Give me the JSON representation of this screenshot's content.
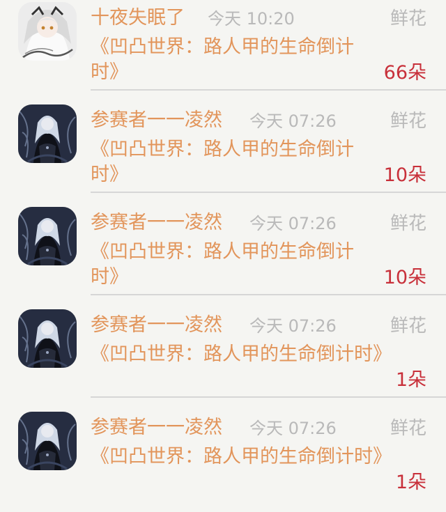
{
  "items": [
    {
      "user": "十夜失眠了",
      "time": "今天 10:20",
      "gift_label": "鲜花",
      "book": "《凹凸世界：路人甲的生命倒计时》",
      "count": "66朵",
      "avatar": "avatar-girl-white-hair"
    },
    {
      "user": "参赛者一一凌然",
      "time": "今天 07:26",
      "gift_label": "鲜花",
      "book": "《凹凸世界：路人甲的生命倒计时》",
      "count": "10朵",
      "avatar": "avatar-dark-anime"
    },
    {
      "user": "参赛者一一凌然",
      "time": "今天 07:26",
      "gift_label": "鲜花",
      "book": "《凹凸世界：路人甲的生命倒计时》",
      "count": "10朵",
      "avatar": "avatar-dark-anime"
    },
    {
      "user": "参赛者一一凌然",
      "time": "今天 07:26",
      "gift_label": "鲜花",
      "book": "《凹凸世界：路人甲的生命倒计时》",
      "count": "1朵",
      "avatar": "avatar-dark-anime"
    },
    {
      "user": "参赛者一一凌然",
      "time": "今天 07:26",
      "gift_label": "鲜花",
      "book": "《凹凸世界：路人甲的生命倒计时》",
      "count": "1朵",
      "avatar": "avatar-dark-anime"
    }
  ],
  "colors": {
    "name": "#e2955b",
    "time": "#b9b9b9",
    "count": "#c8303a",
    "background": "#f5f5f2"
  }
}
